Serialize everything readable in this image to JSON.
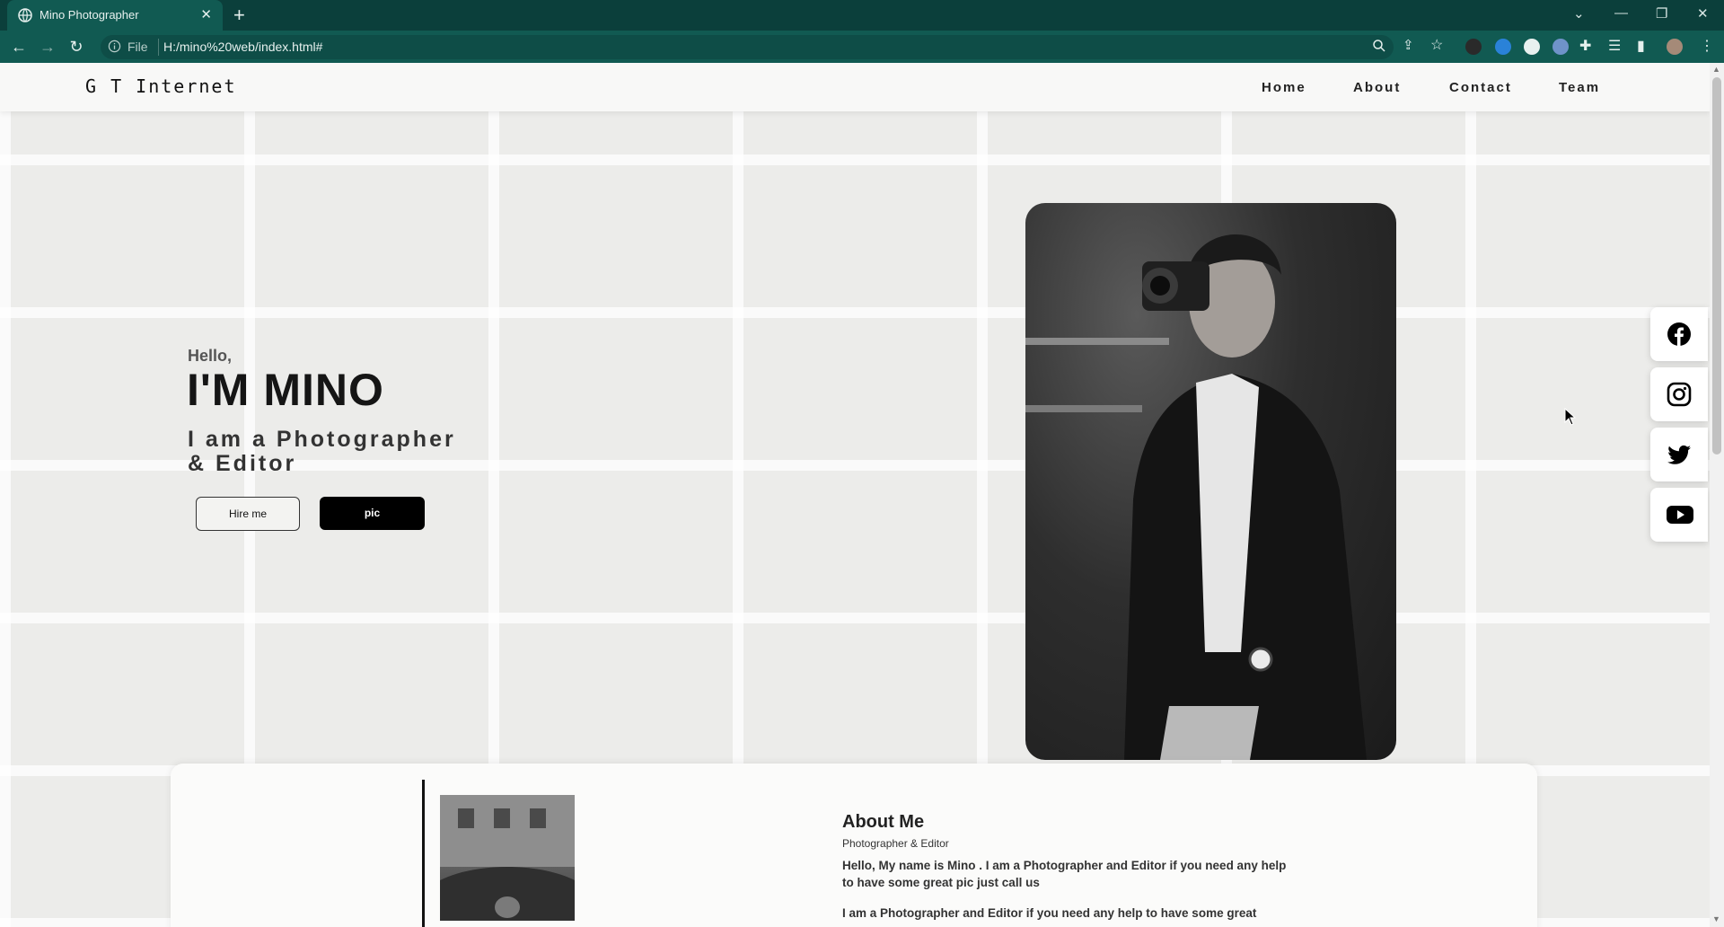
{
  "browser": {
    "tab_title": "Mino Photographer",
    "new_tab_label": "+",
    "omnibox_file_label": "File",
    "url": "H:/mino%20web/index.html#"
  },
  "nav": {
    "brand": "G T Internet",
    "links": [
      "Home",
      "About",
      "Contact",
      "Team"
    ]
  },
  "hero": {
    "greeting": "Hello,",
    "name": "I'M MINO",
    "role_line1": "I am a Photographer",
    "role_line2": "& Editor",
    "hire_label": "Hire me",
    "pic_label": "pic"
  },
  "social": [
    "facebook-icon",
    "instagram-icon",
    "twitter-icon",
    "youtube-icon"
  ],
  "about": {
    "title": "About Me",
    "subtitle": "Photographer & Editor",
    "paragraph1": "Hello, My name is Mino . I am a Photographer and Editor if you need any help to have some great pic just call us",
    "paragraph2": "I am a Photographer and Editor if you need any help to have some great"
  },
  "colors": {
    "chrome_dark": "#0b3f3b",
    "chrome_toolbar": "#115a52",
    "accent_button": "#000000"
  }
}
